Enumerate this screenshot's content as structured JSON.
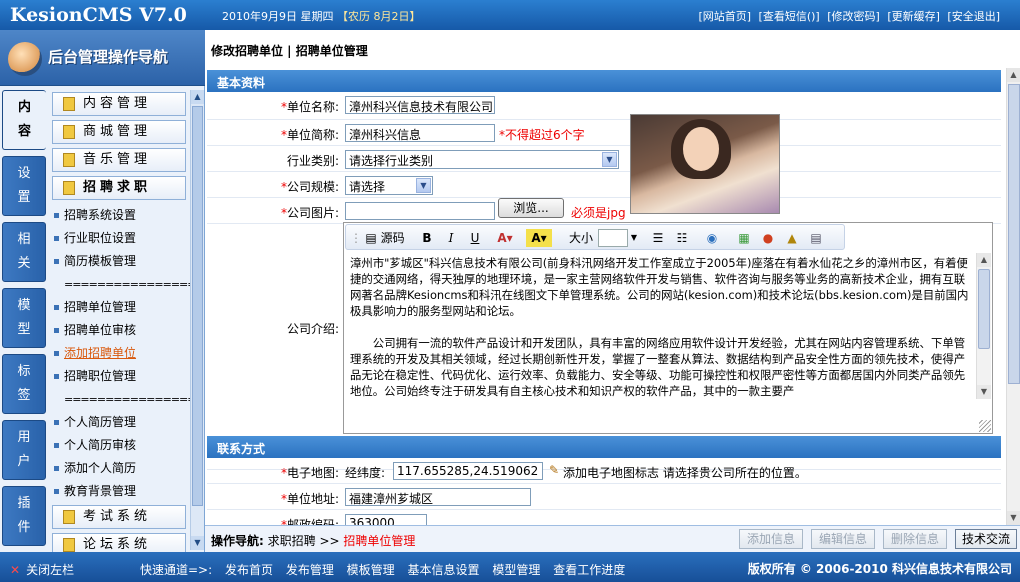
{
  "header": {
    "logo": "KesionCMS V7.0",
    "date": "2010年9月9日 星期四",
    "lunar": "【农历 8月2日】",
    "links": [
      "[网站首页]",
      "[查看短信()]",
      "[修改密码]",
      "[更新缓存]",
      "[安全退出]"
    ]
  },
  "sidebar": {
    "title": "后台管理操作导航",
    "tabs": [
      {
        "line1": "内",
        "line2": "容"
      },
      {
        "line1": "设",
        "line2": "置"
      },
      {
        "line1": "相",
        "line2": "关"
      },
      {
        "line1": "模",
        "line2": "型"
      },
      {
        "line1": "标",
        "line2": "签"
      },
      {
        "line1": "用",
        "line2": "户"
      },
      {
        "line1": "插",
        "line2": "件"
      }
    ],
    "menu_buttons": [
      "内容管理",
      "商城管理",
      "音乐管理",
      "招聘求职",
      "考试系统",
      "论坛系统"
    ],
    "links": [
      "招聘系统设置",
      "行业职位设置",
      "简历模板管理",
      "招聘单位管理",
      "招聘单位审核",
      "添加招聘单位",
      "招聘职位管理",
      "个人简历管理",
      "个人简历审核",
      "添加个人简历",
      "教育背景管理"
    ],
    "separator": "=================="
  },
  "breadcrumb": "修改招聘单位 | 招聘单位管理",
  "form": {
    "section_basic": "基本资料",
    "section_contact": "联系方式",
    "req_mark": "*",
    "unit_name_label": "单位名称:",
    "unit_name_value": "漳州科兴信息技术有限公司",
    "unit_short_label": "单位简称:",
    "unit_short_value": "漳州科兴信息",
    "unit_short_note": "*不得超过6个字",
    "industry_label": "行业类别:",
    "industry_value": "请选择行业类别",
    "scale_label": "公司规模:",
    "scale_value": "请选择",
    "image_label": "公司图片:",
    "image_value": "",
    "browse_label": "浏览...",
    "image_note": "必须是jpg",
    "intro_label": "公司介绍:",
    "map_label": "电子地图:",
    "map_prefix": "经纬度:",
    "map_value": "117.655285,24.519062",
    "map_add": "添加电子地图标志 请选择贵公司所在的位置。",
    "address_label": "单位地址:",
    "address_value": "福建漳州芗城区",
    "zip_label": "邮政编码:",
    "zip_value": "363000"
  },
  "editor": {
    "toolbar": {
      "source": "源码",
      "bold": "B",
      "italic": "I",
      "underline": "U",
      "font_color": "A",
      "bg_color": "A",
      "size_label": "大小"
    },
    "paragraph1": "漳州市\"芗城区\"科兴信息技术有限公司(前身科汛网络开发工作室成立于2005年)座落在有着水仙花之乡的漳州市区，有着便捷的交通网络，得天独厚的地理环境，是一家主营网络软件开发与销售、软件咨询与服务等业务的高新技术企业，拥有互联网著名品牌Kesioncms和科汛在线图文下单管理系统。公司的网站(kesion.com)和技术论坛(bbs.kesion.com)是目前国内极具影响力的服务型网站和论坛。",
    "paragraph2": "公司拥有一流的软件产品设计和开发团队，具有丰富的网络应用软件设计开发经验，尤其在网站内容管理系统、下单管理系统的开发及其相关领域，经过长期创新性开发，掌握了一整套从算法、数据结构到产品安全性方面的领先技术，使得产品无论在稳定性、代码优化、运行效率、负载能力、安全等级、功能可操控性和权限严密性等方面都居国内外同类产品领先地位。公司始终专注于研发具有自主核心技术和知识产权的软件产品，其中的一款主要产"
  },
  "opbar": {
    "nav_label": "操作导航:",
    "nav_path": "求职招聘",
    "nav_arrow": ">>",
    "nav_current": "招聘单位管理",
    "buttons": [
      "添加信息",
      "编辑信息",
      "删除信息",
      "技术交流"
    ]
  },
  "footer": {
    "close_icon": "✕",
    "close_label": "关闭左栏",
    "quick_label": "快速通道=>:",
    "quick_links": [
      "发布首页",
      "发布管理",
      "模板管理",
      "基本信息设置",
      "模型管理",
      "查看工作进度"
    ],
    "copyright": "版权所有 © 2006-2010 科兴信息技术有限公司"
  },
  "colors": {
    "accent": "#2b72c0",
    "required": "#ee0000",
    "active_link": "#d9590d"
  }
}
